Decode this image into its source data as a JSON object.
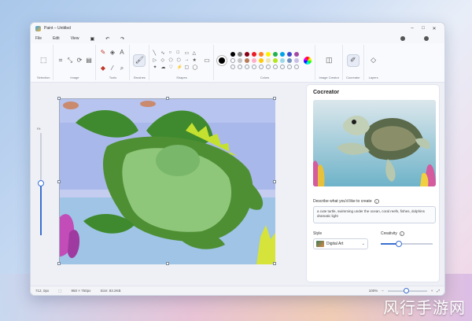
{
  "window": {
    "title": "Paint – Untitled",
    "controls": [
      "–",
      "□",
      "✕"
    ]
  },
  "menu": {
    "items": [
      "File",
      "Edit",
      "View"
    ]
  },
  "ribbon": {
    "groups": {
      "selection": "Selection",
      "image": "Image",
      "tools": "Tools",
      "brushes": "Brushes",
      "shapes": "Shapes",
      "colors": "Colors",
      "image_creator": "Image Creator",
      "cocreator": "Cocreator",
      "layers": "Layers"
    },
    "shape_glyphs": [
      "╲",
      "∿",
      "○",
      "□",
      "▭",
      "△",
      "▷",
      "◇",
      "⬠",
      "⬡",
      "→",
      "★",
      "✦",
      "☁",
      "♡",
      "⚡",
      "▢",
      "◯"
    ],
    "palette": [
      "#000000",
      "#7f7f7f",
      "#880015",
      "#ed1c24",
      "#ff7f27",
      "#fff200",
      "#22b14c",
      "#00a2e8",
      "#3f48cc",
      "#a349a4",
      "#ffffff",
      "#c3c3c3",
      "#b97a57",
      "#ffaec9",
      "#ffc90e",
      "#efe4b0",
      "#b5e61d",
      "#99d9ea",
      "#7092be",
      "#c8bfe7"
    ],
    "primary_color": "#000000"
  },
  "canvas": {
    "zoom_label": "Fit"
  },
  "cocreator_panel": {
    "title": "Cocreator",
    "prompt_label": "Describe what you'd like to create",
    "prompt_text": "a cute turtle, swimming under the ocean, coral reefs, fishes, dolphins dramatic light",
    "style_label": "Style",
    "style_value": "Digital Art",
    "creativity_label": "Creativity",
    "creativity_level": 0.35
  },
  "status": {
    "cursor": "712, 0px",
    "selection": "",
    "canvas_size": "950 × 750px",
    "file_size": "Size: 83.2KB",
    "zoom": "100%"
  },
  "watermark": "风行手游网"
}
